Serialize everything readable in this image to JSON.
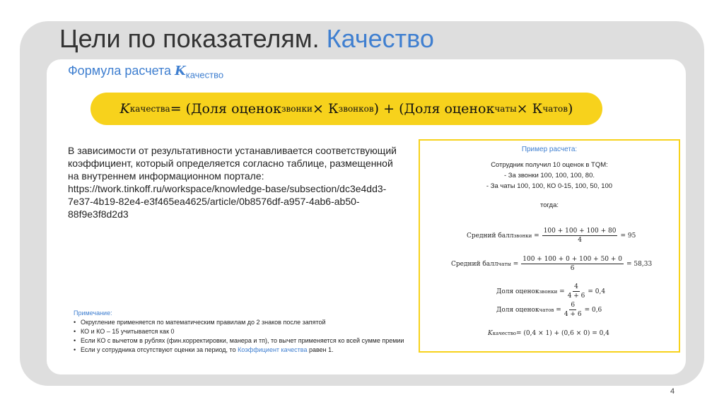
{
  "title": {
    "main": "Цели по показателям. ",
    "accent": "Качество"
  },
  "subtitle": {
    "text": "Формула расчета ",
    "symbol": "K",
    "sub": "качество"
  },
  "formula": {
    "k": "K",
    "k_sub": "качества",
    "eq": " = (Доля оценок",
    "sub1": "звонки",
    "times1": " × К",
    "sub2": "звонков",
    "mid": ") + (Доля оценок",
    "sub3": "чаты",
    "times2": " × К",
    "sub4": "чатов",
    "end": ")"
  },
  "description": {
    "lines": [
      "В зависимости от результативности устанавливается соответствующий",
      "коэффициент, который определяется согласно таблице, размещенной",
      "на внутреннем информационном портале:",
      "https://twork.tinkoff.ru/workspace/knowledge-base/subsection/dc3e4dd3-",
      "7e37-4b19-82e4-e3f465ea4625/article/0b8576df-a957-4ab6-ab50-",
      "88f9e3f8d2d3"
    ]
  },
  "notes": {
    "heading": "Примечание:",
    "items": [
      "Округление применяется по математическим правилам до 2 знаков после запятой",
      "КО и КО – 15 учитывается как 0",
      "Если КО с вычетом в рублях (фин.корректировки, манера и тп), то вычет применяется ко всей сумме премии"
    ],
    "last": {
      "prefix": "Если у сотрудника отсутствуют оценки за период, то ",
      "link": "Коэффициент качества",
      "suffix": " равен 1."
    }
  },
  "example": {
    "title": "Пример расчета:",
    "lines": [
      "Сотрудник получил 10 оценок в TQM:",
      "- За звонки 100, 100, 100, 80.",
      "- За чаты 100, 100, КО 0-15, 100, 50, 100"
    ],
    "then": "тогда:",
    "eq1": {
      "label": "Средний балл",
      "sub": "звонки",
      "eq": "=",
      "num": "100 + 100 + 100 + 80",
      "den": "4",
      "result": "= 95"
    },
    "eq2": {
      "label": "Средний балл",
      "sub": "чаты",
      "eq": "=",
      "num": "100 + 100 + 0 + 100 + 50 + 0",
      "den": "6",
      "result": "= 58,33"
    },
    "eq3": {
      "label": "Доля оценок",
      "sub": "звонки",
      "eq": "=",
      "num": "4",
      "den": "4 + 6",
      "result": "= 0,4"
    },
    "eq4": {
      "label": "Доля оценок",
      "sub": "чатов",
      "eq": "=",
      "num": "6",
      "den": "4 + 6",
      "result": "= 0,6"
    },
    "eq5": {
      "label": "K",
      "sub": "качество",
      "rest": " = (0,4 × 1) + (0,6 × 0) = 0,4"
    }
  },
  "page_number": "4"
}
